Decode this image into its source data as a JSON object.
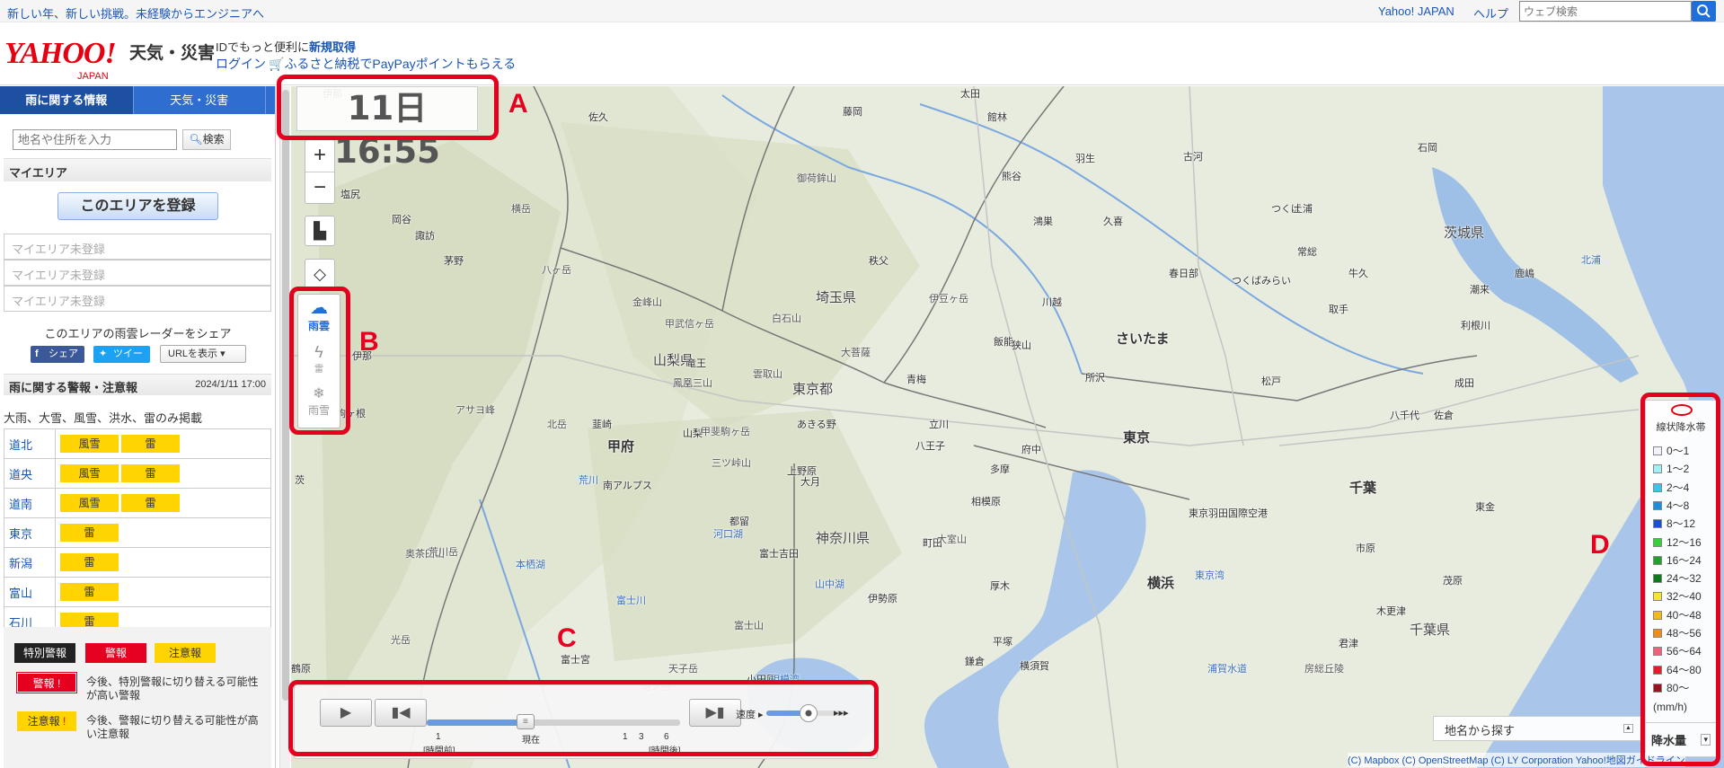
{
  "topbar": {
    "promo": "新しい年、新しい挑戦。未経験からエンジニアへ",
    "yahoo_japan": "Yahoo! JAPAN",
    "help": "ヘルプ",
    "search_placeholder": "ウェブ検索"
  },
  "header": {
    "logo": "YAHOO!",
    "logo_sub": "JAPAN",
    "service": "天気・災害",
    "id_text": "IDでもっと便利に",
    "id_link": "新規取得",
    "login": "ログイン",
    "furusato": "ふるさと納税でPayPayポイントもらえる"
  },
  "sidebar": {
    "tabs": [
      "雨に関する情報",
      "天気・災害"
    ],
    "search_placeholder": "地名や住所を入力",
    "search_button": "検索",
    "myarea_title": "マイエリア",
    "register_button": "このエリアを登録",
    "myarea_slots": [
      "マイエリア未登録",
      "マイエリア未登録",
      "マイエリア未登録"
    ],
    "share_title": "このエリアの雨雲レーダーをシェア",
    "share_fb": "シェア",
    "share_tw": "ツイート",
    "share_url": "URLを表示",
    "warnings_title": "雨に関する警報・注意報",
    "warnings_date": "2024/1/11 17:00",
    "warnings_note": "大雨、大雪、風雪、洪水、雷のみ掲載",
    "warnings": [
      {
        "pref": "道北",
        "tags": [
          "風雪",
          "雷"
        ]
      },
      {
        "pref": "道央",
        "tags": [
          "風雪",
          "雷"
        ]
      },
      {
        "pref": "道南",
        "tags": [
          "風雪",
          "雷"
        ]
      },
      {
        "pref": "東京",
        "tags": [
          "雷"
        ]
      },
      {
        "pref": "新潟",
        "tags": [
          "雷"
        ]
      },
      {
        "pref": "富山",
        "tags": [
          "雷"
        ]
      },
      {
        "pref": "石川",
        "tags": [
          "雷"
        ]
      }
    ],
    "legend": {
      "special": "特別警報",
      "warning": "警報",
      "advisory": "注意報",
      "warning_note": "今後、特別警報に切り替える可能性が高い警報",
      "advisory_note": "今後、警報に切り替える可能性が高い注意報"
    }
  },
  "map": {
    "time": "11日16:55",
    "layers": [
      {
        "label": "雨雲",
        "active": true
      },
      {
        "label": "雷",
        "active": false
      },
      {
        "label": "雨雪",
        "active": false
      }
    ],
    "places": [
      {
        "name": "佐久",
        "kind": "town"
      },
      {
        "name": "藤岡",
        "kind": "town"
      },
      {
        "name": "太田",
        "kind": "town"
      },
      {
        "name": "館林",
        "kind": "town"
      },
      {
        "name": "古河",
        "kind": "town"
      },
      {
        "name": "石岡",
        "kind": "town"
      },
      {
        "name": "御荷鉾山",
        "kind": "mountain"
      },
      {
        "name": "熊谷",
        "kind": "town"
      },
      {
        "name": "羽生",
        "kind": "town"
      },
      {
        "name": "塩尻",
        "kind": "town"
      },
      {
        "name": "岡谷",
        "kind": "town"
      },
      {
        "name": "諏訪",
        "kind": "town"
      },
      {
        "name": "横岳",
        "kind": "mountain"
      },
      {
        "name": "鴻巣",
        "kind": "town"
      },
      {
        "name": "久喜",
        "kind": "town"
      },
      {
        "name": "つくば",
        "kind": "town"
      },
      {
        "name": "土浦",
        "kind": "town"
      },
      {
        "name": "茨城県",
        "kind": "pref"
      },
      {
        "name": "茅野",
        "kind": "town"
      },
      {
        "name": "八ヶ岳",
        "kind": "mountain"
      },
      {
        "name": "秩父",
        "kind": "town"
      },
      {
        "name": "春日部",
        "kind": "town"
      },
      {
        "name": "常総",
        "kind": "town"
      },
      {
        "name": "牛久",
        "kind": "town"
      },
      {
        "name": "つくばみらい",
        "kind": "town"
      },
      {
        "name": "潮来",
        "kind": "town"
      },
      {
        "name": "鹿嶋",
        "kind": "town"
      },
      {
        "name": "埼玉県",
        "kind": "pref"
      },
      {
        "name": "伊豆ヶ岳",
        "kind": "mountain"
      },
      {
        "name": "川越",
        "kind": "town"
      },
      {
        "name": "金峰山",
        "kind": "mountain"
      },
      {
        "name": "白石山",
        "kind": "mountain"
      },
      {
        "name": "取手",
        "kind": "town"
      },
      {
        "name": "甲武信ヶ岳",
        "kind": "mountain"
      },
      {
        "name": "さいたま",
        "kind": "city"
      },
      {
        "name": "利根川",
        "kind": "town"
      },
      {
        "name": "山梨県",
        "kind": "pref"
      },
      {
        "name": "大菩薩",
        "kind": "mountain"
      },
      {
        "name": "飯能",
        "kind": "town"
      },
      {
        "name": "狭山",
        "kind": "town"
      },
      {
        "name": "伊那",
        "kind": "town"
      },
      {
        "name": "雲取山",
        "kind": "mountain"
      },
      {
        "name": "所沢",
        "kind": "town"
      },
      {
        "name": "松戸",
        "kind": "town"
      },
      {
        "name": "成田",
        "kind": "town"
      },
      {
        "name": "鳳凰三山",
        "kind": "mountain"
      },
      {
        "name": "青梅",
        "kind": "town"
      },
      {
        "name": "東京都",
        "kind": "pref"
      },
      {
        "name": "駒ヶ根",
        "kind": "town"
      },
      {
        "name": "アサヨ峰",
        "kind": "mountain"
      },
      {
        "name": "韮崎",
        "kind": "town"
      },
      {
        "name": "あきる野",
        "kind": "town"
      },
      {
        "name": "立川",
        "kind": "town"
      },
      {
        "name": "八千代",
        "kind": "town"
      },
      {
        "name": "佐倉",
        "kind": "town"
      },
      {
        "name": "東京",
        "kind": "city"
      },
      {
        "name": "甲府",
        "kind": "city"
      },
      {
        "name": "山梨",
        "kind": "town"
      },
      {
        "name": "大月",
        "kind": "town"
      },
      {
        "name": "八王子",
        "kind": "town"
      },
      {
        "name": "府中",
        "kind": "town"
      },
      {
        "name": "甲斐駒ヶ岳",
        "kind": "mountain"
      },
      {
        "name": "三ツ峠山",
        "kind": "mountain"
      },
      {
        "name": "上野原",
        "kind": "town"
      },
      {
        "name": "多摩",
        "kind": "town"
      },
      {
        "name": "千葉",
        "kind": "city"
      },
      {
        "name": "南アルプス",
        "kind": "town"
      },
      {
        "name": "東金",
        "kind": "town"
      },
      {
        "name": "相模原",
        "kind": "town"
      },
      {
        "name": "東京羽田国際空港",
        "kind": "town"
      },
      {
        "name": "市原",
        "kind": "town"
      },
      {
        "name": "河口湖",
        "kind": "water"
      },
      {
        "name": "都留",
        "kind": "town"
      },
      {
        "name": "神奈川県",
        "kind": "pref"
      },
      {
        "name": "町田",
        "kind": "town"
      },
      {
        "name": "大室山",
        "kind": "mountain"
      },
      {
        "name": "茂原",
        "kind": "town"
      },
      {
        "name": "北岳",
        "kind": "mountain"
      },
      {
        "name": "奥茶臼山",
        "kind": "mountain"
      },
      {
        "name": "荒川岳",
        "kind": "mountain"
      },
      {
        "name": "本栖湖",
        "kind": "water"
      },
      {
        "name": "富士吉田",
        "kind": "town"
      },
      {
        "name": "山中湖",
        "kind": "water"
      },
      {
        "name": "厚木",
        "kind": "town"
      },
      {
        "name": "横浜",
        "kind": "city"
      },
      {
        "name": "東京湾",
        "kind": "water"
      },
      {
        "name": "木更津",
        "kind": "town"
      },
      {
        "name": "富士川",
        "kind": "water"
      },
      {
        "name": "伊勢原",
        "kind": "town"
      },
      {
        "name": "千葉県",
        "kind": "pref"
      },
      {
        "name": "富士山",
        "kind": "mountain"
      },
      {
        "name": "平塚",
        "kind": "town"
      },
      {
        "name": "君津",
        "kind": "town"
      },
      {
        "name": "光岳",
        "kind": "mountain"
      },
      {
        "name": "鎌倉",
        "kind": "town"
      },
      {
        "name": "横須賀",
        "kind": "town"
      },
      {
        "name": "房総丘陵",
        "kind": "mountain"
      },
      {
        "name": "小田原",
        "kind": "town"
      },
      {
        "name": "相模湾",
        "kind": "water"
      },
      {
        "name": "浦賀水道",
        "kind": "water"
      },
      {
        "name": "鶴原",
        "kind": "town"
      },
      {
        "name": "塔ノ岳",
        "kind": "mountain"
      },
      {
        "name": "富士宮",
        "kind": "town"
      },
      {
        "name": "天子岳",
        "kind": "mountain"
      },
      {
        "name": "伊那",
        "kind": "town"
      },
      {
        "name": "茨",
        "kind": "town"
      },
      {
        "name": "荒川",
        "kind": "water"
      },
      {
        "name": "竜王",
        "kind": "town"
      },
      {
        "name": "北浦",
        "kind": "water"
      }
    ],
    "player": {
      "ticks": [
        "1",
        "現在",
        "1",
        "3",
        "6"
      ],
      "tick_sub_left": "[時間前]",
      "tick_sub_right": "[時間後]",
      "speed_label": "速度",
      "position_fraction": 0.39
    },
    "legend": {
      "title": "線状降水帯",
      "rows": [
        {
          "label": "0〜1",
          "color": "#f2f2ff"
        },
        {
          "label": "1〜2",
          "color": "#a0f0f8"
        },
        {
          "label": "2〜4",
          "color": "#2ecbe8"
        },
        {
          "label": "4〜8",
          "color": "#1a8fe0"
        },
        {
          "label": "8〜12",
          "color": "#1a4de0"
        },
        {
          "label": "12〜16",
          "color": "#36d13a"
        },
        {
          "label": "16〜24",
          "color": "#21a12b"
        },
        {
          "label": "24〜32",
          "color": "#0d7a1b"
        },
        {
          "label": "32〜40",
          "color": "#f5e431"
        },
        {
          "label": "40〜48",
          "color": "#f5b816"
        },
        {
          "label": "48〜56",
          "color": "#f08a1a"
        },
        {
          "label": "56〜64",
          "color": "#f0607a"
        },
        {
          "label": "64〜80",
          "color": "#e01d28"
        },
        {
          "label": "80〜",
          "color": "#a0101e"
        }
      ],
      "unit": "(mm/h)",
      "footer": "降水量"
    },
    "place_search": "地名から探す",
    "credits": "(C) Mapbox  (C) OpenStreetMap  (C) LY Corporation  Yahoo!地図ガイドライン"
  },
  "annotations": [
    "A",
    "B",
    "C",
    "D"
  ],
  "annotation_color": "#e6001f"
}
